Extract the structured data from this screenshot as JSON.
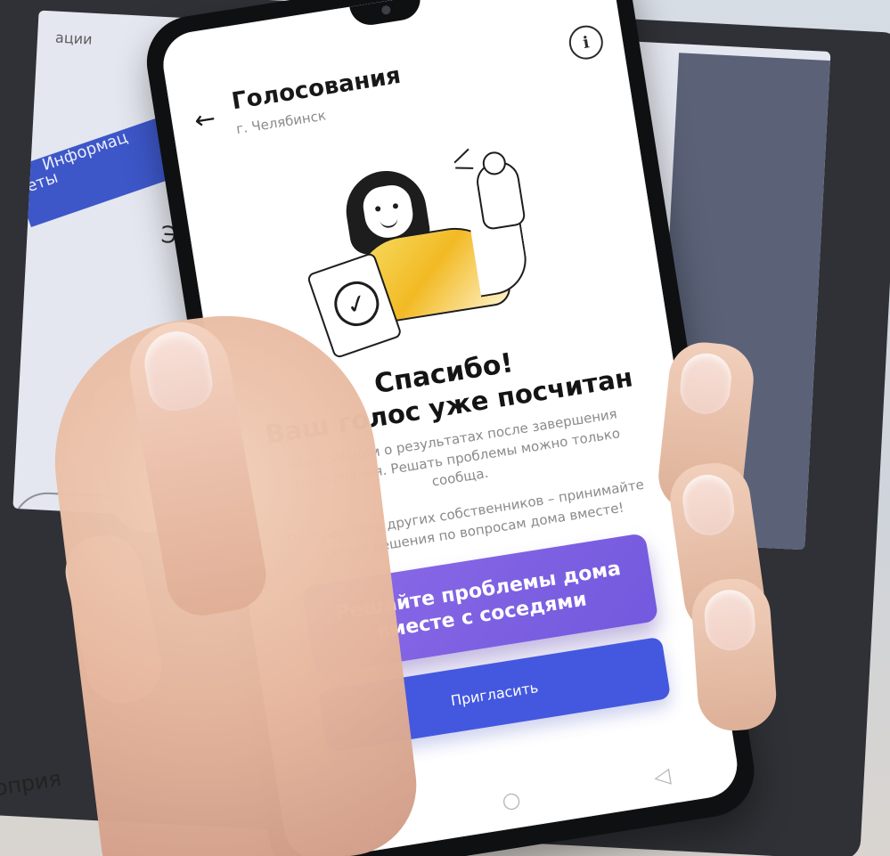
{
  "background": {
    "monitor_texts": [
      "ации",
      "Информац",
      "еты",
      "Эл",
      "роприя"
    ]
  },
  "app": {
    "title": "Голосования",
    "subtitle": "г. Челябинск",
    "info_icon": "info-icon",
    "back_icon": "back-arrow-icon"
  },
  "content": {
    "thanks_title": "Спасибо!",
    "vote_counted": "Ваш голос уже посчитан",
    "result_note": "Мы сообщим о результатах после завершения голосования. Решать проблемы можно только сообща.",
    "invite_note": "Приглашайте других собственников – принимайте важные решения по вопросам дома вместе!",
    "promo_button": "Решайте проблемы дома вместе с соседями",
    "invite_button": "Пригласить"
  },
  "colors": {
    "accent_purple": "#7A5EE3",
    "accent_blue": "#4458DF",
    "monitor_blue": "#3D57C9"
  },
  "icons": {
    "check": "check-icon",
    "nav_back": "nav-back-icon",
    "nav_home": "nav-home-icon",
    "nav_recent": "nav-recent-icon"
  }
}
